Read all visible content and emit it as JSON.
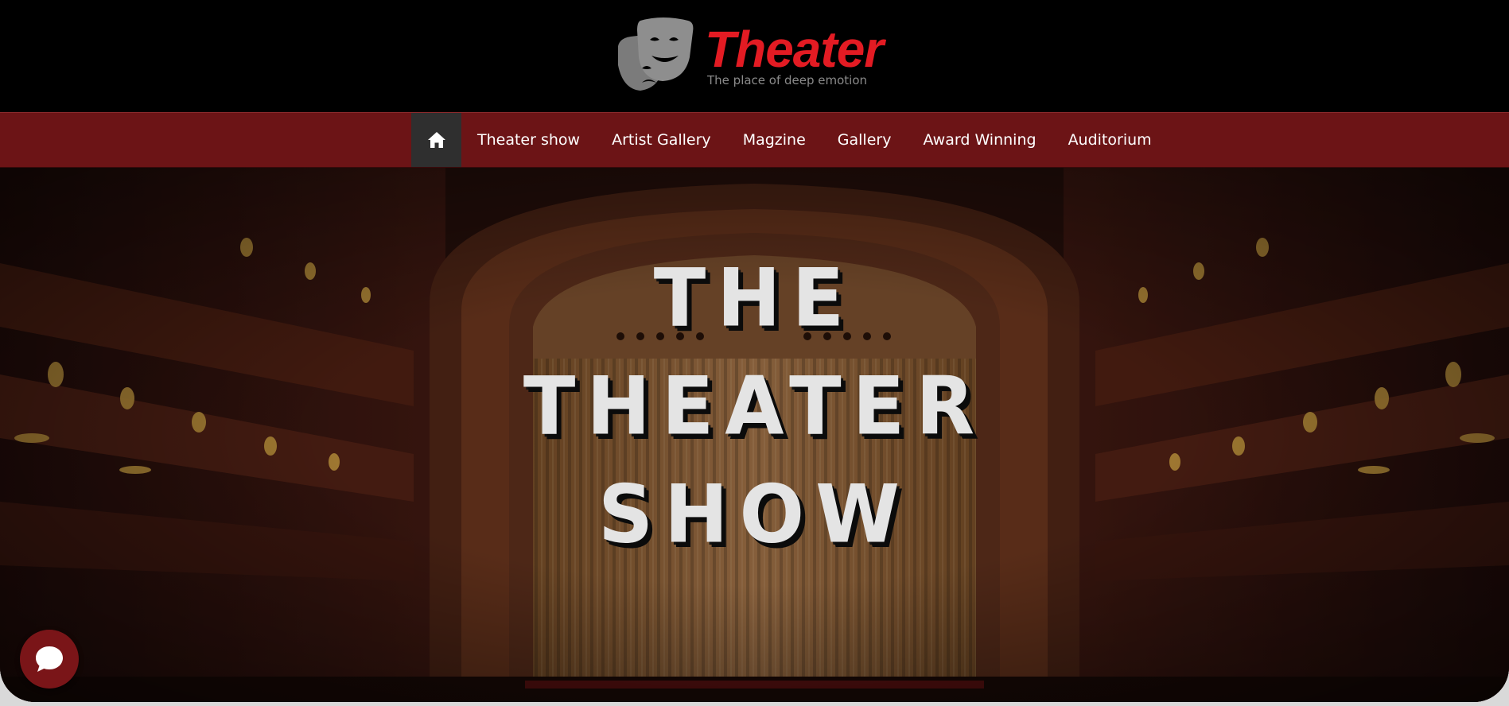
{
  "brand": {
    "title": "Theater",
    "tagline": "The place of deep emotion",
    "title_color": "#e31b23",
    "logo_icon": "theater-masks-icon"
  },
  "nav": {
    "home_icon": "home-icon",
    "items": [
      "Theater show",
      "Artist Gallery",
      "Magzine",
      "Gallery",
      "Award Winning",
      "Auditorium"
    ],
    "bar_color": "#6c1416",
    "home_bg": "#2f2f2f"
  },
  "hero": {
    "lines": [
      "THE",
      "THEATER",
      "SHOW"
    ],
    "background": "theater-auditorium-stage-photo"
  },
  "chat": {
    "icon": "chat-bubble-icon",
    "color": "#7a1518"
  }
}
